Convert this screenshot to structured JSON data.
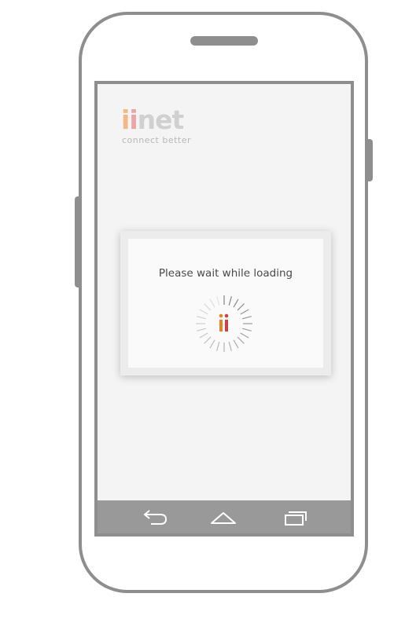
{
  "app": {
    "logo_text": "iinet",
    "tagline": "connect  better"
  },
  "dialog": {
    "message": "Please wait while loading"
  },
  "colors": {
    "accent_orange": "#e8841e",
    "accent_red": "#d23f3f",
    "frame_gray": "#8e8e8e",
    "navbar_gray": "#999999",
    "screen_bg": "#f4f4f4"
  },
  "icons": {
    "back": "back-arrow-icon",
    "home": "home-icon",
    "recent": "recent-apps-icon"
  }
}
